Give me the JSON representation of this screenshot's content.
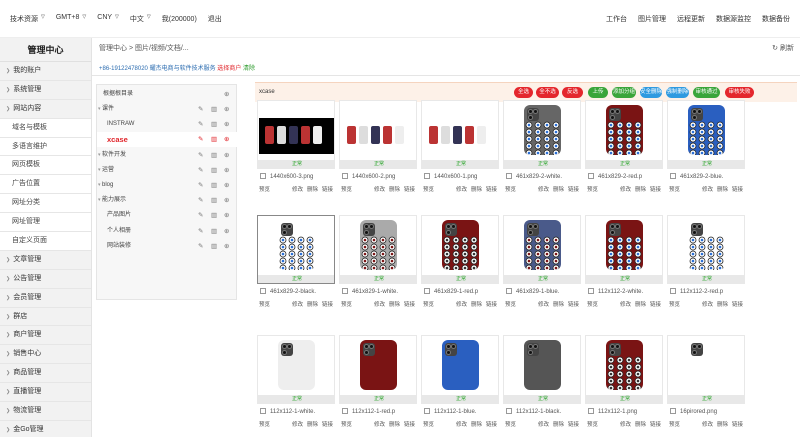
{
  "topbar": {
    "left": [
      "技术资源",
      "GMT+8",
      "CNY",
      "中文",
      "我(200000)",
      "退出"
    ],
    "right": [
      "工作台",
      "图片管理",
      "远程更新",
      "数据源监控",
      "数据备份"
    ]
  },
  "sidebar": {
    "title": "管理中心",
    "items": [
      "我的账户",
      "系统管理",
      "网站内容",
      "域名与模板",
      "多语言维护",
      "网页模板",
      "广告位置",
      "网址分类",
      "网址管理",
      "自定义页面",
      "文章管理",
      "公告管理",
      "会员管理",
      "群店",
      "商户管理",
      "销售中心",
      "商品管理",
      "直播管理",
      "物流管理",
      "金Go管理"
    ]
  },
  "breadcrumb": "管理中心 > 图片/视频/文档/...",
  "refresh_label": "刷新",
  "contact": {
    "phone": "+86-19122478020",
    "company": "耀杰电商与软件技术服务",
    "select": "选择商户",
    "clear": "清除"
  },
  "folder_panel": {
    "root_label": "根据根目录",
    "folders": [
      "课件",
      "INSTRAW",
      "xcase",
      "软件开发",
      "运营",
      "blog",
      "能力展示",
      "产品图片",
      "个人相册",
      "网站装修"
    ]
  },
  "toolbar": {
    "current_folder": "xcase",
    "buttons": [
      "全选",
      "全不选",
      "反选",
      "上传",
      "添加分组",
      "安全删除",
      "强制删除",
      "审核通过",
      "审核失败"
    ]
  },
  "images": [
    {
      "name": "1440x600-3.png",
      "status": "正常"
    },
    {
      "name": "1440x600-2.png",
      "status": "正常"
    },
    {
      "name": "1440x600-1.png",
      "status": "正常"
    },
    {
      "name": "461x829-2-white.",
      "status": "正常"
    },
    {
      "name": "461x829-2-red.p",
      "status": "正常"
    },
    {
      "name": "461x829-2-blue.",
      "status": "正常"
    },
    {
      "name": "461x829-2-black.",
      "status": "正常"
    },
    {
      "name": "461x829-1-white.",
      "status": "正常"
    },
    {
      "name": "461x829-1-red.p",
      "status": "正常"
    },
    {
      "name": "461x829-1-blue.",
      "status": "正常"
    },
    {
      "name": "112x112-2-white.",
      "status": "正常"
    },
    {
      "name": "112x112-2-red.p",
      "status": "正常"
    },
    {
      "name": "112x112-1-white.",
      "status": "正常"
    },
    {
      "name": "112x112-1-red.p",
      "status": "正常"
    },
    {
      "name": "112x112-1-blue.",
      "status": "正常"
    },
    {
      "name": "112x112-1-black.",
      "status": "正常"
    },
    {
      "name": "112x112-1.png",
      "status": "正常"
    },
    {
      "name": "16pirored.png",
      "status": "正常"
    }
  ],
  "card_actions": {
    "preview": "预览",
    "edit": "修改",
    "delete": "删除",
    "link": "链接"
  },
  "colors": {
    "red": "#e4262c",
    "green": "#3aa53a",
    "blue": "#2f9ae0",
    "case_red": "#7a1414",
    "case_blue": "#2a5fc0",
    "case_gray": "#666666",
    "case_white": "#eeeeee"
  }
}
